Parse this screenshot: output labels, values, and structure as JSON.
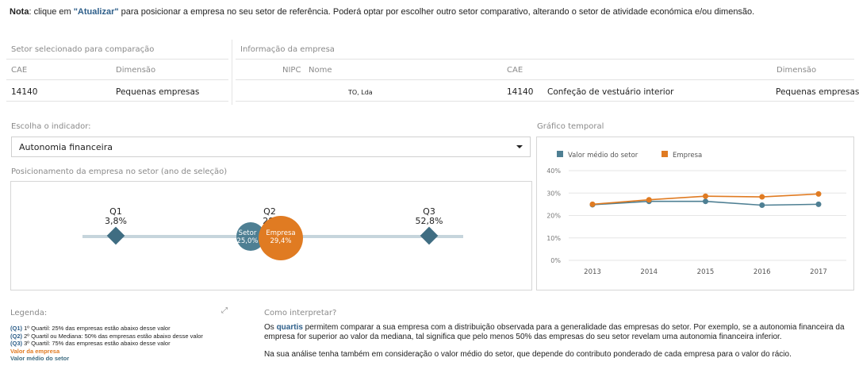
{
  "note": {
    "prefix": "Nota",
    "text_before": ": clique em ",
    "action": "\"Atualizar\"",
    "text_after": " para posicionar a empresa no seu setor de referência. Poderá optar por escolher outro setor comparativo, alterando o setor de atividade económica e/ou dimensão."
  },
  "sector_panel": {
    "title": "Setor selecionado para comparação",
    "cae_label": "CAE",
    "dim_label": "Dimensão",
    "cae_value": "14140",
    "dim_value": "Pequenas empresas"
  },
  "company_panel": {
    "title": "Informação da empresa",
    "nipc_label": "NIPC",
    "name_label": "Nome",
    "cae_label": "CAE",
    "dim_label": "Dimensão",
    "name_value": "TO, Lda",
    "cae_value": "14140",
    "cae_desc": "Confeção de vestuário interior",
    "dim_value": "Pequenas empresas"
  },
  "indicator": {
    "label": "Escolha o indicador:",
    "selected": "Autonomia financeira"
  },
  "positioning": {
    "title": "Posicionamento da empresa no setor (ano de seleção)",
    "q1_label": "Q1",
    "q1_value": "3,8%",
    "q2_label": "Q2",
    "q2_value": "28,",
    "q3_label": "Q3",
    "q3_value": "52,8%",
    "setor_label": "Setor",
    "setor_value": "25,0%",
    "empresa_label": "Empresa",
    "empresa_value": "29,4%"
  },
  "temporal": {
    "title": "Gráfico temporal"
  },
  "chart_data": {
    "type": "line",
    "x": [
      "2013",
      "2014",
      "2015",
      "2016",
      "2017"
    ],
    "series": [
      {
        "name": "Valor médio do setor",
        "values": [
          24.8,
          26.3,
          26.3,
          24.6,
          25.0
        ],
        "color": "#4e7f93"
      },
      {
        "name": "Empresa",
        "values": [
          25.0,
          27.0,
          28.6,
          28.3,
          29.6
        ],
        "color": "#e07b22"
      }
    ],
    "y_ticks": [
      "0%",
      "10%",
      "20%",
      "30%",
      "40%"
    ],
    "ylim": [
      0,
      40
    ],
    "legend_position": "top-left",
    "grid": true
  },
  "legend": {
    "title": "Legenda:",
    "lines": [
      {
        "key": "(Q1)",
        "text": " 1º Quartil: 25% das empresas estão abaixo desse valor"
      },
      {
        "key": "(Q2)",
        "text": " 2º Quartil ou Mediana: 50% das empresas estão abaixo desse valor"
      },
      {
        "key": "(Q3)",
        "text": " 3º Quartil: 75% das empresas estão abaixo desse valor"
      }
    ],
    "empresa_line": "Valor da empresa",
    "setor_line": "Valor médio do setor",
    "expand_icon": "expand-icon"
  },
  "interpretation": {
    "title": "Como interpretar?",
    "p1_before": "Os ",
    "p1_hl": "quartis",
    "p1_after": " permitem comparar a sua empresa com a distribuição observada para a generalidade das empresas do setor. Por exemplo, se a autonomia financeira da empresa for superior ao valor da mediana, tal significa que pelo menos 50% das empresas do seu setor revelam uma autonomia financeira inferior.",
    "p2": "Na sua análise tenha também em consideração o valor médio do setor, que depende do contributo ponderado de cada empresa para o valor do rácio."
  },
  "colors": {
    "setor": "#4e7f93",
    "empresa": "#e07b22",
    "quartile": "#3f6d82",
    "track": "#c6d5dc"
  }
}
